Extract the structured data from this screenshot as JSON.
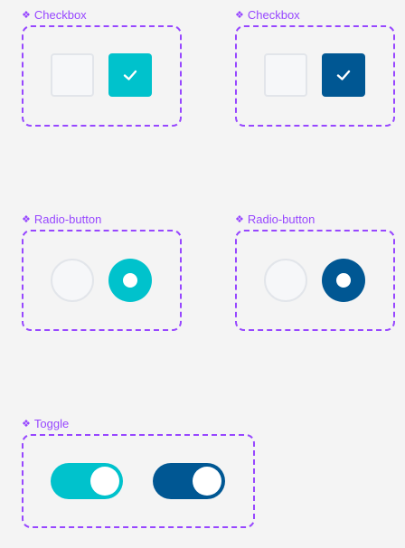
{
  "colors": {
    "component_purple": "#9747ff",
    "teal": "#00c2cc",
    "navy": "#005793",
    "unchecked_fill": "#f6f7f9",
    "unchecked_border": "#e2e5ea",
    "background": "#f4f4f4"
  },
  "groups": {
    "checkbox_teal": {
      "label": "Checkbox",
      "icon": "component-diamond-icon",
      "items": [
        {
          "state": "unchecked"
        },
        {
          "state": "checked",
          "color": "#00c2cc",
          "icon": "checkmark-icon"
        }
      ]
    },
    "checkbox_navy": {
      "label": "Checkbox",
      "icon": "component-diamond-icon",
      "items": [
        {
          "state": "unchecked"
        },
        {
          "state": "checked",
          "color": "#005793",
          "icon": "checkmark-icon"
        }
      ]
    },
    "radio_teal": {
      "label": "Radio-button",
      "icon": "component-diamond-icon",
      "items": [
        {
          "state": "unselected"
        },
        {
          "state": "selected",
          "color": "#00c2cc"
        }
      ]
    },
    "radio_navy": {
      "label": "Radio-button",
      "icon": "component-diamond-icon",
      "items": [
        {
          "state": "unselected"
        },
        {
          "state": "selected",
          "color": "#005793"
        }
      ]
    },
    "toggle": {
      "label": "Toggle",
      "icon": "component-diamond-icon",
      "items": [
        {
          "state": "on",
          "color": "#00c2cc"
        },
        {
          "state": "on",
          "color": "#005793"
        }
      ]
    }
  }
}
